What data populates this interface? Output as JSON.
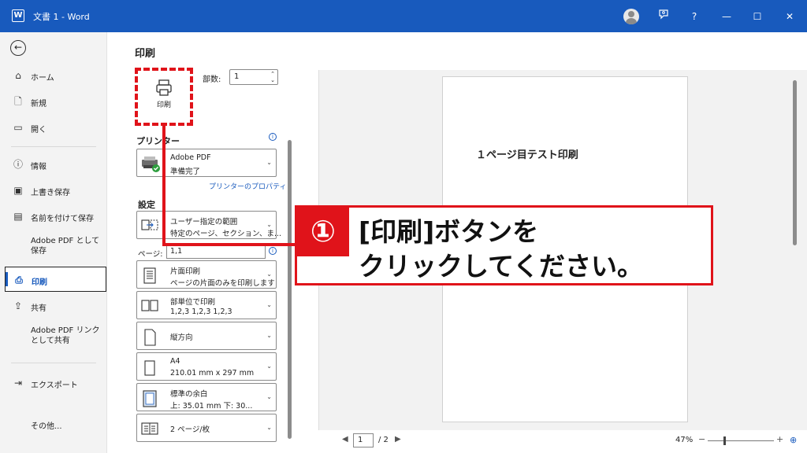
{
  "window": {
    "title": "文書 1  -  Word",
    "app_icon": "W"
  },
  "titlebar_buttons": {
    "minimize": "—",
    "maximize": "☐",
    "close": "✕",
    "help": "?"
  },
  "sidebar": {
    "items": [
      {
        "label": "ホーム",
        "icon": "home-icon"
      },
      {
        "label": "新規",
        "icon": "new-doc-icon"
      },
      {
        "label": "開く",
        "icon": "folder-open-icon"
      },
      {
        "label": "情報",
        "icon": "info-icon"
      },
      {
        "label": "上書き保存",
        "icon": "save-icon"
      },
      {
        "label": "名前を付けて保存",
        "icon": "save-as-icon"
      },
      {
        "label": "Adobe PDF として\n保存",
        "icon": ""
      },
      {
        "label": "印刷",
        "icon": "printer-icon"
      },
      {
        "label": "共有",
        "icon": "share-icon"
      },
      {
        "label": "Adobe PDF リンク\nとして共有",
        "icon": ""
      },
      {
        "label": "エクスポート",
        "icon": "export-icon"
      },
      {
        "label": "その他...",
        "icon": ""
      }
    ]
  },
  "print": {
    "title": "印刷",
    "button_label": "印刷",
    "copies_label": "部数:",
    "copies_value": "1",
    "printer_section": "プリンター",
    "printer_name": "Adobe PDF",
    "printer_status": "準備完了",
    "printer_props_link": "プリンターのプロパティ",
    "settings_section": "設定",
    "range_line1": "ユーザー指定の範囲",
    "range_line2": "特定のページ、セクション、ま...",
    "pages_label": "ページ:",
    "pages_value": "1,1",
    "sides_line1": "片面印刷",
    "sides_line2": "ページの片面のみを印刷します",
    "collate_line1": "部単位で印刷",
    "collate_line2": "1,2,3    1,2,3    1,2,3",
    "orientation": "縦方向",
    "paper_line1": "A4",
    "paper_line2": "210.01 mm x 297 mm",
    "margin_line1": "標準の余白",
    "margin_line2": "上: 35.01 mm 下: 30...",
    "per_sheet": "2 ページ/枚"
  },
  "preview": {
    "page_text": "１ページ目テスト印刷",
    "current_page": "1",
    "total_pages": "/ 2",
    "zoom": "47%"
  },
  "annotation": {
    "number": "①",
    "line1": "[印刷]ボタンを",
    "line2": "クリックしてください。",
    "color": "#e0131a"
  }
}
